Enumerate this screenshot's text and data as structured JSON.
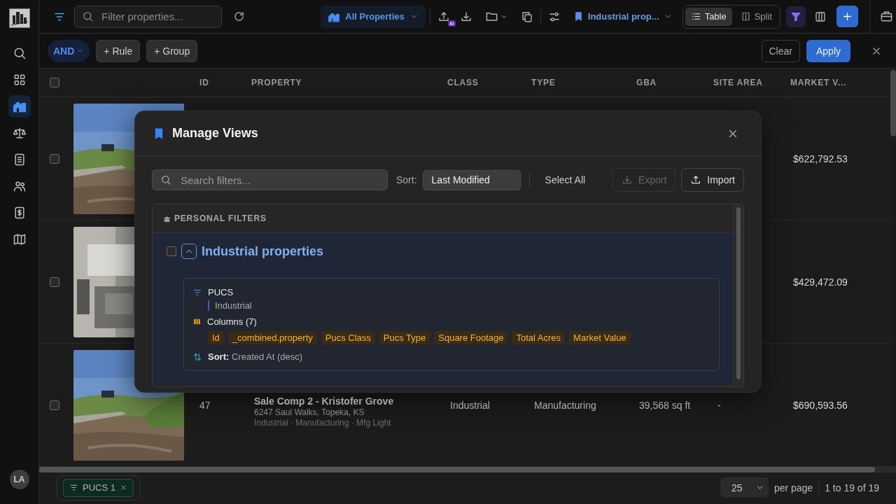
{
  "sidebar": {
    "items": [
      {
        "kind": "search",
        "selected": false
      },
      {
        "kind": "grid",
        "selected": false
      },
      {
        "kind": "buildings",
        "selected": true
      },
      {
        "kind": "scale",
        "selected": false
      },
      {
        "kind": "notebook",
        "selected": false
      },
      {
        "kind": "people",
        "selected": false
      },
      {
        "kind": "dollar",
        "selected": false
      },
      {
        "kind": "map",
        "selected": false
      }
    ],
    "avatar": "LA"
  },
  "toolbar": {
    "search": {
      "placeholder": "Filter properties..."
    },
    "view_selector": "All Properties",
    "ai_badge": "AI",
    "saved_view": "Industrial prop...",
    "modes": [
      {
        "kind": "list",
        "label": "Table",
        "selected": true
      },
      {
        "kind": "split",
        "label": "Split",
        "selected": false
      }
    ],
    "filter_active": true
  },
  "filter_bar": {
    "operator": "AND",
    "buttons": [
      "+ Rule",
      "+ Group"
    ],
    "clear": "Clear",
    "apply": "Apply"
  },
  "table": {
    "select_all_checked": false,
    "columns": [
      "ID",
      "PROPERTY",
      "CLASS",
      "TYPE",
      "GBA",
      "SITE AREA",
      "MARKET V..."
    ],
    "rows": [
      {
        "checked": false,
        "market_value": "$622,792.53"
      },
      {
        "checked": false,
        "market_value": "$429,472.09"
      },
      {
        "checked": false,
        "id": "47",
        "name": "Sale Comp 2 - Kristofer Grove",
        "address": "6247 Saul Walks, Topeka, KS",
        "tags": "Industrial · Manufacturing · Mfg Light",
        "class": "Industrial",
        "type": "Manufacturing",
        "gba": "39,568 sq ft",
        "site_area": "-",
        "market_value": "$690,593.56"
      }
    ]
  },
  "footer": {
    "chips": [
      {
        "label": "PUCS 1"
      }
    ],
    "page_size": "25",
    "per_page": "per page",
    "range": "1 to 19 of 19"
  },
  "modal": {
    "title": "Manage Views",
    "search": {
      "placeholder": "Search filters..."
    },
    "sort_label": "Sort:",
    "sort_value": "Last Modified",
    "select_all": "Select All",
    "export": {
      "label": "Export",
      "disabled": true
    },
    "import": {
      "label": "Import",
      "disabled": false
    },
    "section": "PERSONAL FILTERS",
    "views": [
      {
        "name": "Industrial properties",
        "checked": false,
        "expanded": true,
        "filters": [
          {
            "field": "PUCS",
            "values": [
              "Industrial"
            ]
          }
        ],
        "columns_label": "Columns (7)",
        "columns": [
          "Id",
          "_combined.property",
          "Pucs Class",
          "Pucs Type",
          "Square Footage",
          "Total Acres",
          "Market Value"
        ],
        "sort_label": "Sort:",
        "sort": "Created At (desc)"
      }
    ]
  }
}
